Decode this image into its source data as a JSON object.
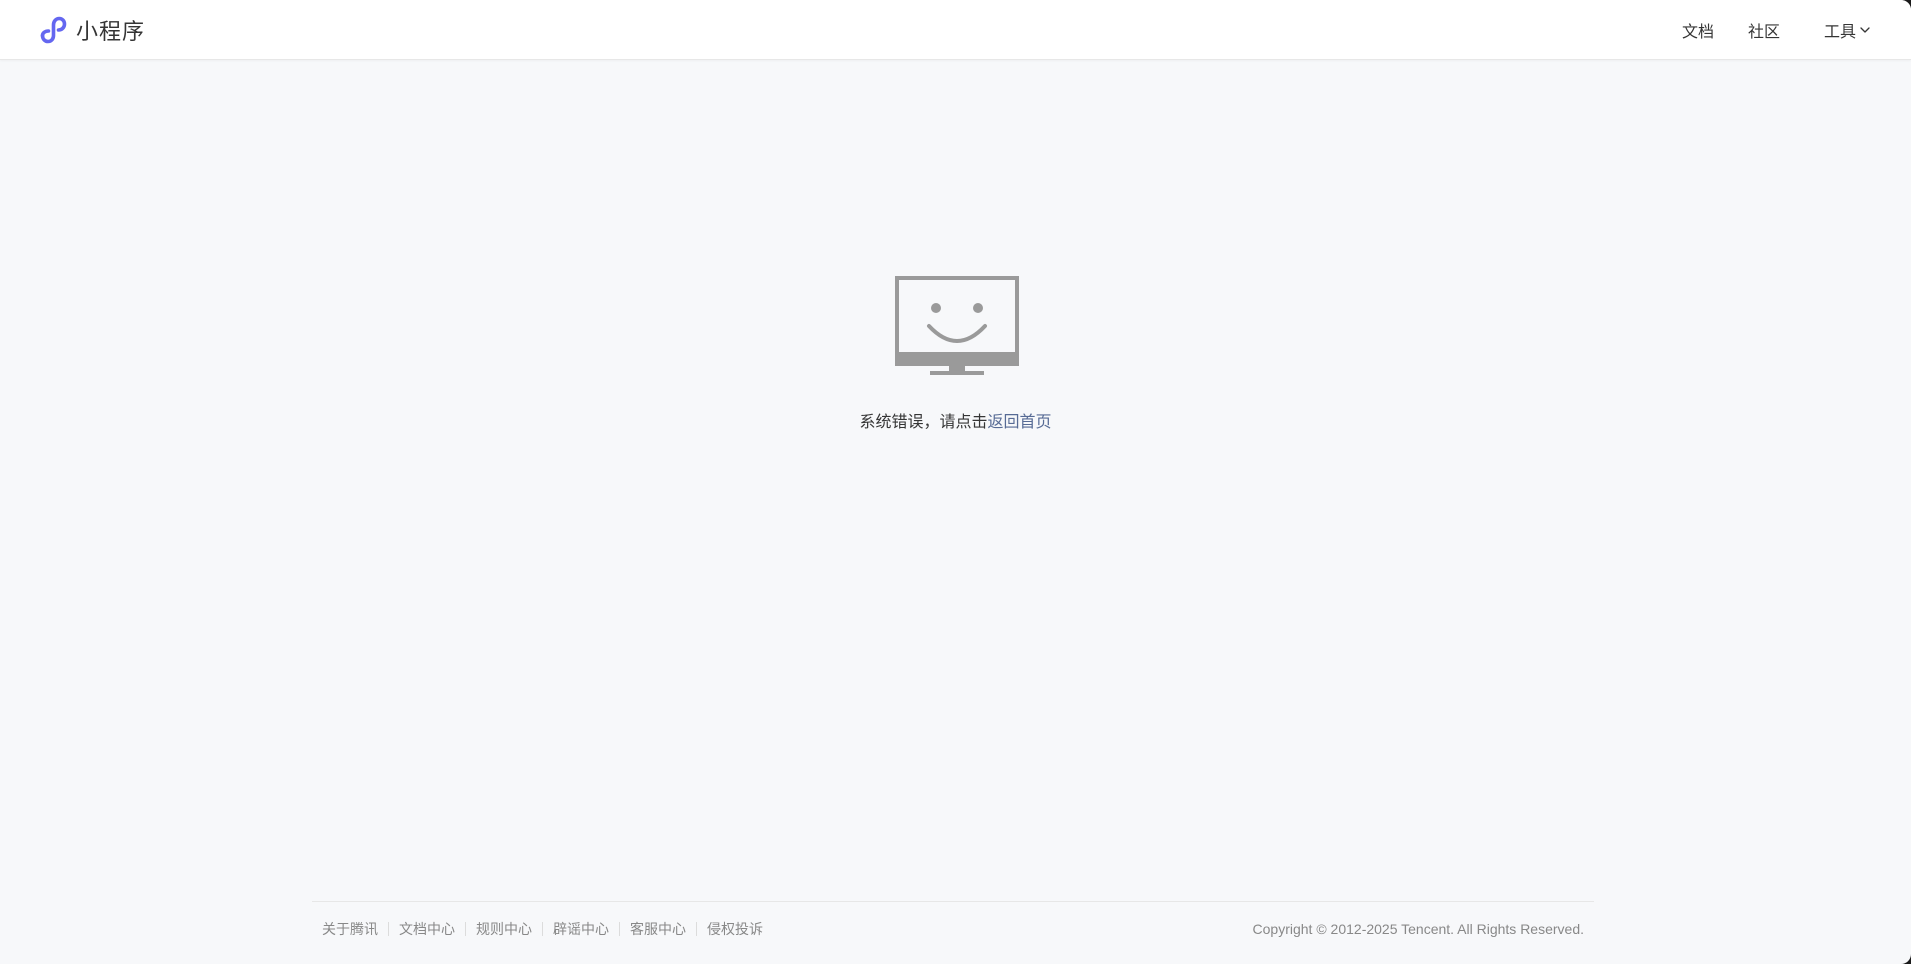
{
  "header": {
    "brand_text": "小程序",
    "nav": [
      {
        "label": "文档"
      },
      {
        "label": "社区"
      },
      {
        "label": "工具"
      }
    ]
  },
  "error": {
    "message": "系统错误，请点击",
    "link_text": "返回首页"
  },
  "footer": {
    "links": [
      {
        "label": "关于腾讯"
      },
      {
        "label": "文档中心"
      },
      {
        "label": "规则中心"
      },
      {
        "label": "辟谣中心"
      },
      {
        "label": "客服中心"
      },
      {
        "label": "侵权投诉"
      }
    ],
    "copyright": "Copyright © 2012-2025 Tencent. All Rights Reserved."
  },
  "icons": {
    "brand": "miniprogram-logo-icon",
    "tools_dropdown": "chevron-down-icon",
    "error": "smiling-monitor-icon"
  },
  "colors": {
    "brand": "#6467f0",
    "link": "#576b95",
    "text": "#353535",
    "muted": "#888888",
    "icon_gray": "#9a9a9a",
    "background": "#f7f8fa"
  }
}
